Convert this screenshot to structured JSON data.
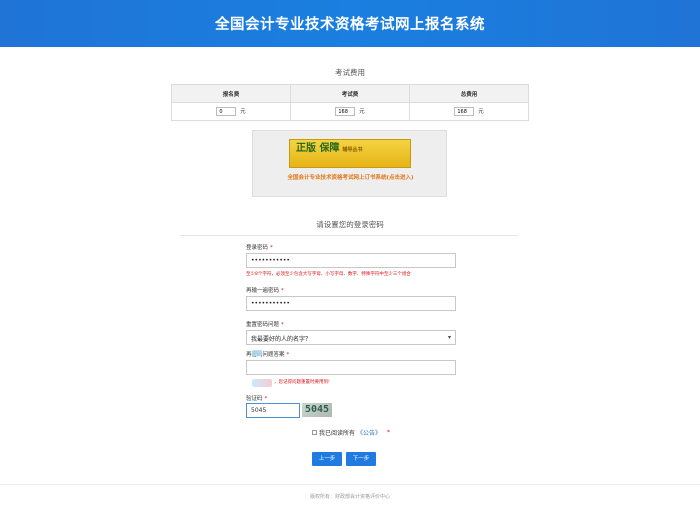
{
  "header": {
    "title": "全国会计专业技术资格考试网上报名系统"
  },
  "fees": {
    "title": "考试费用",
    "headers": [
      "报名费",
      "考试费",
      "总费用"
    ],
    "values": [
      "0",
      "168",
      "168"
    ],
    "unit": "元"
  },
  "banner": {
    "image_text": "正版 保障",
    "image_subtext": "辅导丛书",
    "link": "全国会计专业技术资格考试网上订书系统(点击进入)"
  },
  "password_section": {
    "title": "请设置您的登录密码",
    "login_password_label": "登录密码",
    "login_password_value": "•••••••••••",
    "password_hint": "至少8个字符，必须至少包含大写字母、小写字母、数字、特殊字符中至少三个组合",
    "confirm_password_label": "再输一遍密码",
    "confirm_password_value": "•••••••••••",
    "question_label": "重置密码问题",
    "question_value": "我最要好的人的名字？",
    "answer_label": "再密码问题答案",
    "answer_value": "",
    "answer_hint": "，您记得问题重置时要用到!",
    "captcha_label": "验证码",
    "captcha_value": "5045",
    "captcha_image_text": "5045",
    "required_mark": "*"
  },
  "agreement": {
    "text": "我已阅读所有",
    "link": "《公告》",
    "required_mark": "*"
  },
  "buttons": {
    "prev": "上一步",
    "next": "下一步"
  },
  "footer": {
    "text": "版权所有：财政部会计资格评价中心"
  }
}
